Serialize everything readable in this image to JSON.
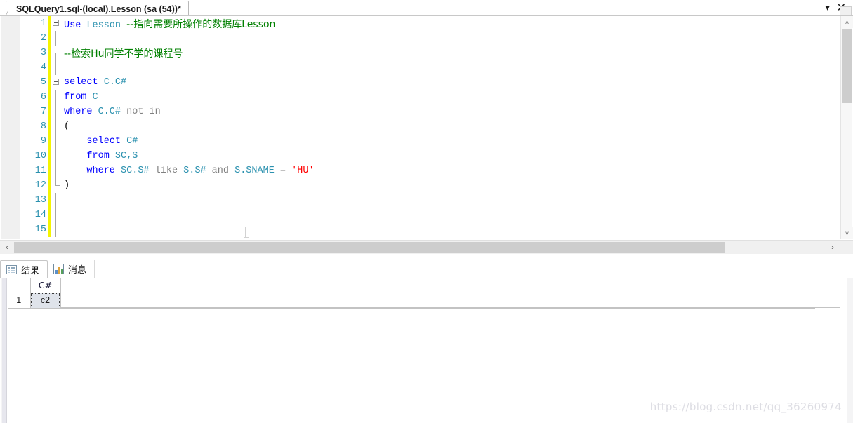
{
  "window": {
    "tab_title_bold_1": "SQLQuery1.sql",
    "tab_title_sep": " - ",
    "tab_title_bold_2": "(local).Lesson (sa (54))*",
    "dropdown_icon": "chevron-down-icon",
    "close_icon": "close-icon",
    "close_glyph": "✕",
    "chevron_glyph": "▾"
  },
  "editor": {
    "lines": [
      {
        "num": "1",
        "fold": "start",
        "changed": true,
        "tokens": [
          {
            "t": "Use ",
            "c": "kw"
          },
          {
            "t": "Lesson",
            "c": "id"
          },
          {
            "t": " ",
            "c": "plain"
          },
          {
            "t": "--指向需要所操作的数据库Lesson",
            "c": "cmt"
          }
        ]
      },
      {
        "num": "2",
        "fold": "line",
        "changed": true,
        "tokens": []
      },
      {
        "num": "3",
        "fold": "dash",
        "changed": true,
        "tokens": [
          {
            "t": "--检索Hu同学不学的课程号",
            "c": "cmt"
          }
        ]
      },
      {
        "num": "4",
        "fold": "line",
        "changed": true,
        "tokens": []
      },
      {
        "num": "5",
        "fold": "start",
        "changed": true,
        "tokens": [
          {
            "t": "select ",
            "c": "kw"
          },
          {
            "t": "C.C#",
            "c": "id"
          }
        ]
      },
      {
        "num": "6",
        "fold": "line",
        "changed": true,
        "tokens": [
          {
            "t": "from ",
            "c": "kw"
          },
          {
            "t": "C",
            "c": "id"
          }
        ]
      },
      {
        "num": "7",
        "fold": "line",
        "changed": true,
        "tokens": [
          {
            "t": "where ",
            "c": "kw"
          },
          {
            "t": "C.C#",
            "c": "id"
          },
          {
            "t": " ",
            "c": "plain"
          },
          {
            "t": "not in",
            "c": "gray"
          }
        ]
      },
      {
        "num": "8",
        "fold": "line",
        "changed": true,
        "tokens": [
          {
            "t": "(",
            "c": "plain"
          }
        ]
      },
      {
        "num": "9",
        "fold": "line",
        "changed": true,
        "tokens": [
          {
            "t": "    select ",
            "c": "kw"
          },
          {
            "t": "C#",
            "c": "id"
          }
        ]
      },
      {
        "num": "10",
        "fold": "line",
        "changed": true,
        "tokens": [
          {
            "t": "    from ",
            "c": "kw"
          },
          {
            "t": "SC,S",
            "c": "id"
          }
        ]
      },
      {
        "num": "11",
        "fold": "line",
        "changed": true,
        "tokens": [
          {
            "t": "    where ",
            "c": "kw"
          },
          {
            "t": "SC.S#",
            "c": "id"
          },
          {
            "t": " ",
            "c": "plain"
          },
          {
            "t": "like",
            "c": "gray"
          },
          {
            "t": " ",
            "c": "plain"
          },
          {
            "t": "S.S#",
            "c": "id"
          },
          {
            "t": " ",
            "c": "plain"
          },
          {
            "t": "and",
            "c": "gray"
          },
          {
            "t": " ",
            "c": "plain"
          },
          {
            "t": "S.SNAME",
            "c": "id"
          },
          {
            "t": " ",
            "c": "plain"
          },
          {
            "t": "=",
            "c": "gray"
          },
          {
            "t": " ",
            "c": "plain"
          },
          {
            "t": "'HU'",
            "c": "str"
          }
        ]
      },
      {
        "num": "12",
        "fold": "end",
        "changed": true,
        "tokens": [
          {
            "t": ")",
            "c": "plain"
          }
        ]
      },
      {
        "num": "13",
        "fold": "line",
        "changed": true,
        "tokens": []
      },
      {
        "num": "14",
        "fold": "line",
        "changed": true,
        "tokens": []
      },
      {
        "num": "15",
        "fold": "line",
        "changed": true,
        "tokens": []
      }
    ],
    "scrollbar": {
      "up_arrow": "˄",
      "down_arrow": "˅",
      "left_arrow": "‹",
      "right_arrow": "›"
    }
  },
  "results": {
    "tabs": [
      {
        "label": "结果",
        "icon": "results-grid-icon",
        "active": true
      },
      {
        "label": "消息",
        "icon": "messages-icon",
        "active": false
      }
    ],
    "grid": {
      "columns": [
        "C#"
      ],
      "rows": [
        {
          "num": "1",
          "cells": [
            "c2"
          ]
        }
      ]
    }
  },
  "watermark": {
    "text": "https://blog.csdn.net/qq_36260974"
  },
  "colors": {
    "keyword": "#0000ff",
    "identifier": "#2b91af",
    "comment": "#008000",
    "string": "#ff0000",
    "operator": "#808080",
    "linenumber": "#2b91af",
    "changebar": "#f4f400",
    "selected_cell": "#dfe3ea"
  }
}
